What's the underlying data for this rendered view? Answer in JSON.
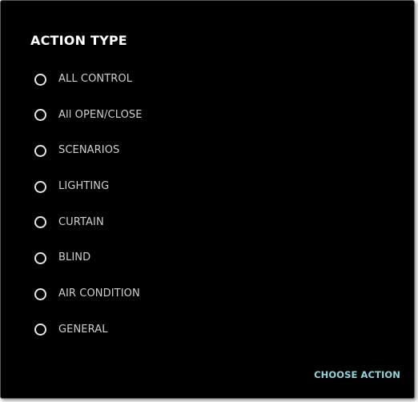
{
  "dialog": {
    "title": "ACTION TYPE",
    "options": [
      {
        "label": "ALL CONTROL",
        "selected": false
      },
      {
        "label": "All OPEN/CLOSE",
        "selected": false
      },
      {
        "label": "SCENARIOS",
        "selected": false
      },
      {
        "label": "LIGHTING",
        "selected": false
      },
      {
        "label": "CURTAIN",
        "selected": false
      },
      {
        "label": "BLIND",
        "selected": false
      },
      {
        "label": "AIR CONDITION",
        "selected": false
      },
      {
        "label": "GENERAL",
        "selected": false
      }
    ],
    "confirm_label": "CHOOSE ACTION"
  },
  "colors": {
    "background": "#000000",
    "title": "#ffffff",
    "option_text": "#cfcfcf",
    "radio_ring": "#e6e6e6",
    "accent": "#8fd3dc"
  },
  "icons": {
    "radio": "radio-unchecked-icon"
  }
}
